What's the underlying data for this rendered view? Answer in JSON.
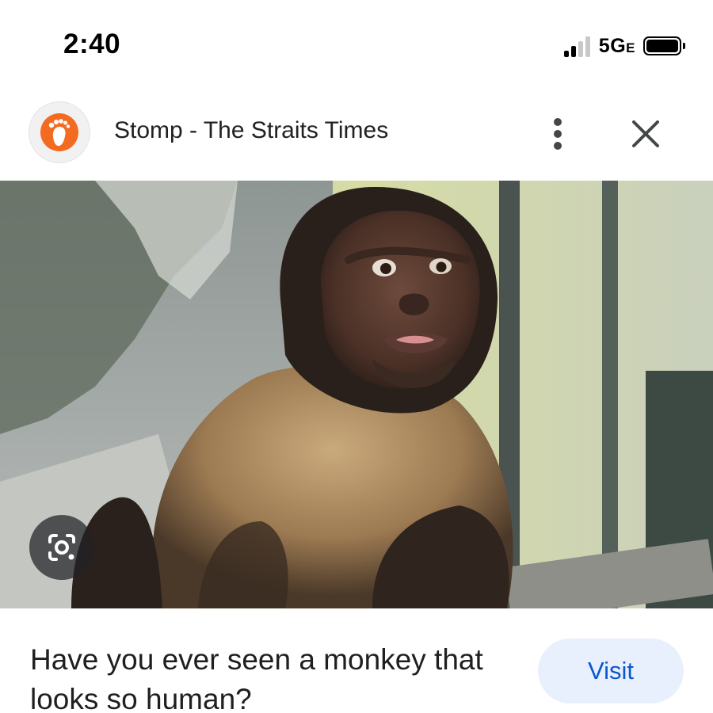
{
  "status_bar": {
    "time": "2:40",
    "network": "5G",
    "network_suffix": "E",
    "signal_bars_filled": 2,
    "signal_bars_total": 4,
    "battery_level": 1.0
  },
  "source": {
    "title": "Stomp - The Straits Times",
    "logo_icon": "footprint-icon",
    "logo_color": "#f26b21"
  },
  "image": {
    "subject_icon": "photo-monkey"
  },
  "lens": {
    "icon": "google-lens-icon"
  },
  "caption": {
    "text": "Have you ever seen a monkey that looks so human?"
  },
  "actions": {
    "visit_label": "Visit",
    "more_icon": "more-vertical-icon",
    "close_icon": "close-icon"
  },
  "colors": {
    "visit_bg": "#e8f0fe",
    "visit_text": "#0b57d0"
  }
}
